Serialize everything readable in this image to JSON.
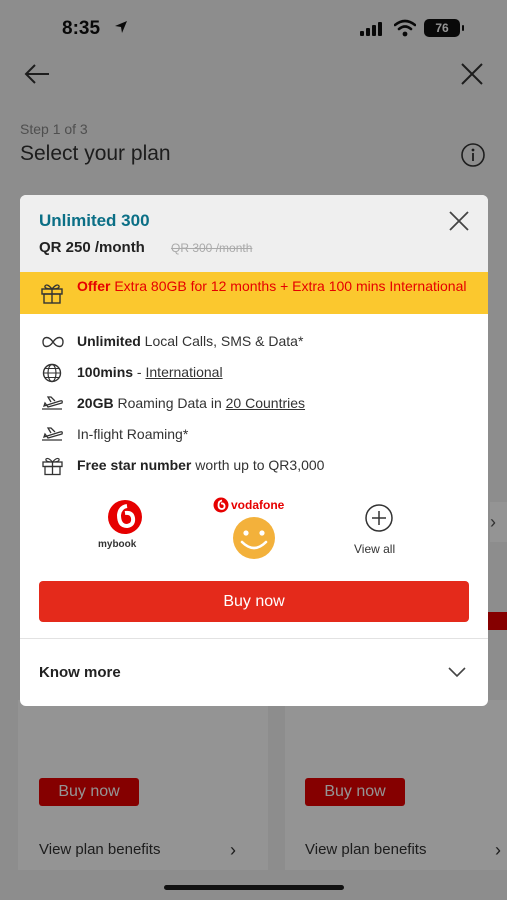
{
  "status_bar": {
    "time": "8:35",
    "battery": "76"
  },
  "page": {
    "step": "Step 1 of 3",
    "title": "Select your plan"
  },
  "background_cards": [
    {
      "buy_label": "Buy now",
      "benefits_label": "View plan benefits"
    },
    {
      "buy_label": "Buy now",
      "benefits_label": "View plan benefits"
    }
  ],
  "modal": {
    "plan_name": "Unlimited 300",
    "price": "QR 250 /month",
    "old_price": "QR 300 /month",
    "offer": {
      "prefix": "Offer",
      "text": " Extra 80GB for 12 months + Extra 100 mins International"
    },
    "benefits": [
      {
        "icon": "infinity-icon",
        "bold": "Unlimited",
        "text": " Local Calls, SMS & Data*",
        "link": ""
      },
      {
        "icon": "globe-icon",
        "bold": "100mins",
        "text": " - ",
        "link": "International"
      },
      {
        "icon": "plane-icon",
        "bold": "20GB",
        "text": " Roaming Data in ",
        "link": "20 Countries"
      },
      {
        "icon": "plane-icon",
        "bold": "",
        "text": "In-flight Roaming*",
        "link": ""
      },
      {
        "icon": "gift-icon",
        "bold": "Free star number",
        "text": " worth up to QR3,000",
        "link": ""
      }
    ],
    "partners": {
      "mybook_label": "mybook",
      "vodafone_label": "vodafone",
      "view_all_label": "View all"
    },
    "buy_label": "Buy now",
    "know_more_label": "Know more"
  },
  "colors": {
    "brand_red": "#e42a1b",
    "offer_yellow": "#fbc82e",
    "plan_teal": "#0b6f86"
  }
}
